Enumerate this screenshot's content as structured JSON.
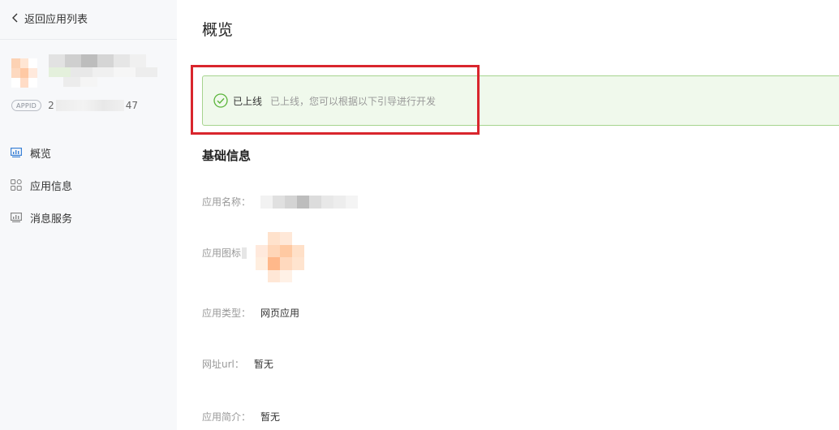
{
  "sidebar": {
    "back_label": "返回应用列表",
    "appid_badge": "APPID",
    "appid_prefix": "2",
    "appid_suffix": "47",
    "items": [
      {
        "label": "概览",
        "icon": "chart-bar-icon"
      },
      {
        "label": "应用信息",
        "icon": "grid-icon"
      },
      {
        "label": "消息服务",
        "icon": "monitor-icon"
      }
    ]
  },
  "main": {
    "title": "概览",
    "status": {
      "label": "已上线",
      "description": "已上线，您可以根据以下引导进行开发",
      "icon": "check-circle-icon",
      "color": "#5bb53b"
    },
    "section_title": "基础信息",
    "fields": {
      "name_label": "应用名称：",
      "icon_label": "应用图标",
      "type_label": "应用类型：",
      "type_value": "网页应用",
      "url_label": "网址url：",
      "url_value": "暂无",
      "intro_label": "应用简介：",
      "intro_value": "暂无"
    }
  },
  "colors": {
    "highlight_border": "#d9262d",
    "alert_bg": "#f0f9ec",
    "alert_border": "#a6d48e",
    "nav_icon": "#3b82d6"
  }
}
